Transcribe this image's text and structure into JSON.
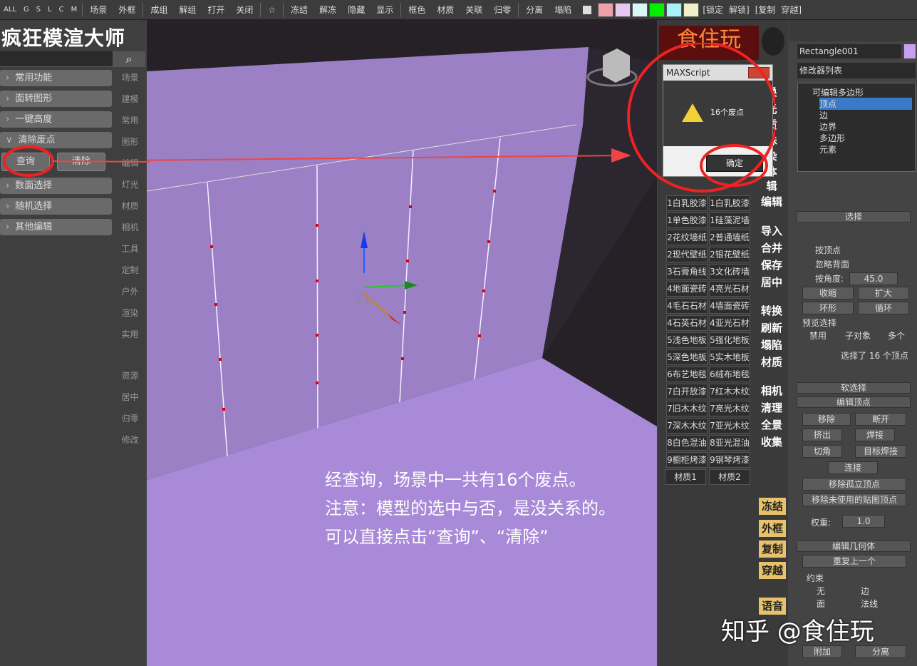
{
  "toolbar": {
    "items": [
      "ALL",
      "G",
      "S",
      "L",
      "C",
      "M",
      "场景",
      "外框",
      "成组",
      "解组",
      "打开",
      "关闭",
      "☆",
      "冻结",
      "解冻",
      "隐藏",
      "显示",
      "框色",
      "材质",
      "关联",
      "归零",
      "分离",
      "塌陷"
    ],
    "swatches": [
      "#f0a0a8",
      "#e8c8f0",
      "#d8f8f8",
      "#00f000",
      "#a8f0f8",
      "#f0f0c8"
    ],
    "right_items": [
      "[锁定",
      "解锁]",
      "[复制",
      "穿越]"
    ]
  },
  "left": {
    "title": "疯狂模渲大师",
    "buttons": [
      "常用功能",
      "面转图形",
      "一键高度",
      "清除废点",
      "数面选择",
      "随机选择",
      "其他编辑"
    ],
    "side": [
      "场景",
      "建模",
      "常用",
      "图形",
      "编辑",
      "灯光",
      "材质",
      "相机",
      "工具",
      "定制",
      "户外",
      "渲染",
      "实用",
      "资源",
      "居中",
      "归零",
      "修改"
    ],
    "query": "查询",
    "clear": "清除"
  },
  "mid": {
    "logo": "食住玩",
    "dialog_title": "MAXScript",
    "dialog_msg": "16个废点",
    "ok": "确定",
    "right_col": [
      "换",
      "光",
      "质",
      "殊",
      "染",
      "体",
      "辑",
      "编辑",
      "导入",
      "合并",
      "保存",
      "居中",
      "转换",
      "刷新",
      "塌陷",
      "材质",
      "相机",
      "清理",
      "全景",
      "收集"
    ],
    "mats_a": [
      "1白乳胶漆",
      "1单色胶漆",
      "2花纹墙纸",
      "2现代壁纸",
      "3石膏角线",
      "4地面瓷砖",
      "4毛石石材",
      "4石英石材",
      "5浅色地板",
      "5深色地板",
      "6布艺地毯",
      "7白开放漆",
      "7旧木木纹",
      "7深木木纹",
      "8白色混油",
      "9橱柜烤漆"
    ],
    "mats_b": [
      "1白乳胶漆",
      "1硅藻泥墙",
      "2普通墙纸",
      "2银花壁纸",
      "3文化砖墙",
      "4亮光石材",
      "4墙面瓷砖",
      "4亚光石材",
      "5强化地板",
      "5实木地板",
      "6绒布地毯",
      "7红木木纹",
      "7亮光木纹",
      "7亚光木纹",
      "8亚光混油",
      "9钢琴烤漆"
    ],
    "mat_tabs": [
      "材质1",
      "材质2"
    ],
    "yellow": [
      "冻结",
      "外框",
      "复制",
      "穿越",
      "语音"
    ]
  },
  "right": {
    "object": "Rectangle001",
    "modifier_list": "修改器列表",
    "stack": [
      "可编辑多边形",
      "顶点",
      "边",
      "边界",
      "多边形",
      "元素"
    ],
    "select_title": "选择",
    "by_vertex": "按顶点",
    "ignore_back": "忽略背面",
    "by_angle": "按角度:",
    "angle_val": "45.0",
    "shrink": "收缩",
    "grow": "扩大",
    "ring": "环形",
    "loop": "循环",
    "preview": "预览选择",
    "disable": "禁用",
    "subobj": "子对象",
    "multi": "多个",
    "selected": "选择了 16 个顶点",
    "soft": "软选择",
    "edit_vtx": "编辑顶点",
    "remove": "移除",
    "break": "断开",
    "extrude": "挤出",
    "weld": "焊接",
    "chamfer": "切角",
    "target_weld": "目标焊接",
    "connect": "连接",
    "remove_iso": "移除孤立顶点",
    "remove_unused": "移除未使用的贴图顶点",
    "weight": "权重:",
    "weight_val": "1.0",
    "edit_geo": "编辑几何体",
    "repeat": "重复上一个",
    "constraint": "约束",
    "none": "无",
    "edge": "边",
    "face": "面",
    "normal": "法线",
    "attach": "附加",
    "detach": "分离"
  },
  "annotation": [
    "经查询，场景中一共有16个废点。",
    "注意：模型的选中与否，是没关系的。",
    "可以直接点击“查询”、“清除”"
  ],
  "watermark": "知乎 @食住玩"
}
